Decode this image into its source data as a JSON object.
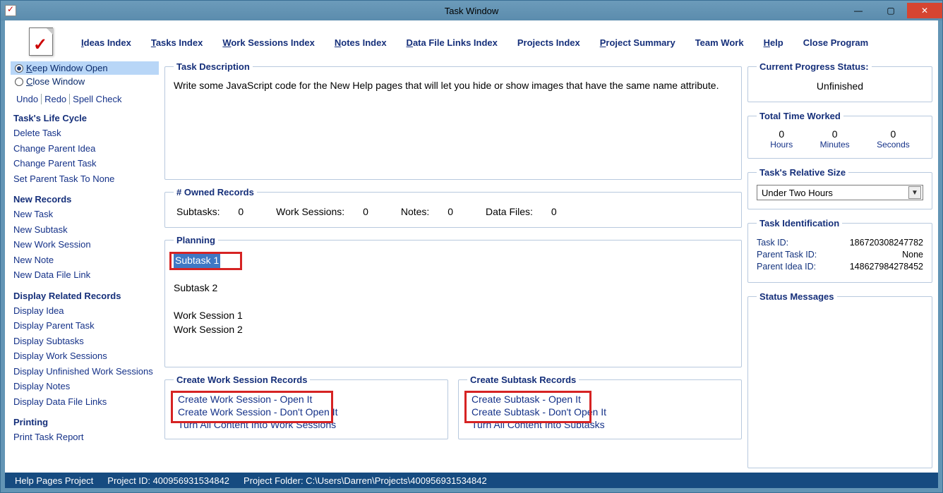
{
  "window": {
    "title": "Task Window"
  },
  "nav": {
    "ideas": "Ideas Index",
    "tasks": "Tasks Index",
    "work_sessions": "Work Sessions Index",
    "notes": "Notes Index",
    "data_file_links": "Data File Links Index",
    "projects": "Projects Index",
    "project_summary": "Project Summary",
    "team_work": "Team Work",
    "help": "Help",
    "close": "Close Program"
  },
  "sidebar": {
    "keep_open": "Keep Window Open",
    "close_window": "Close Window",
    "undo": "Undo",
    "redo": "Redo",
    "spell": "Spell Check",
    "life_cycle_head": "Task's Life Cycle",
    "life_cycle": [
      "Delete Task",
      "Change Parent Idea",
      "Change Parent Task",
      "Set Parent Task To None"
    ],
    "new_records_head": "New Records",
    "new_records": [
      "New Task",
      "New Subtask",
      "New Work Session",
      "New Note",
      "New Data File Link"
    ],
    "display_head": "Display Related Records",
    "display": [
      "Display Idea",
      "Display Parent Task",
      "Display Subtasks",
      "Display Work Sessions",
      "Display Unfinished Work Sessions",
      "Display Notes",
      "Display Data File Links"
    ],
    "printing_head": "Printing",
    "printing": [
      "Print Task Report"
    ]
  },
  "task_description": {
    "legend": "Task Description",
    "text": "Write some JavaScript code for the New Help pages that will let you hide or show images that have the same name attribute."
  },
  "owned": {
    "legend": "# Owned Records",
    "subtasks_label": "Subtasks:",
    "subtasks_val": "0",
    "ws_label": "Work Sessions:",
    "ws_val": "0",
    "notes_label": "Notes:",
    "notes_val": "0",
    "df_label": "Data Files:",
    "df_val": "0"
  },
  "planning": {
    "legend": "Planning",
    "subtask1": "Subtask 1",
    "subtask2": "Subtask 2",
    "ws1": "Work Session 1",
    "ws2": "Work Session 2"
  },
  "create_ws": {
    "legend": "Create Work Session Records",
    "open": "Create Work Session - Open It",
    "dont": "Create Work Session - Don't Open It",
    "turn_all": "Turn All Content Into Work Sessions"
  },
  "create_st": {
    "legend": "Create Subtask Records",
    "open": "Create Subtask - Open It",
    "dont": "Create Subtask - Don't Open It",
    "turn_all": "Turn All Content Into Subtasks"
  },
  "progress": {
    "legend": "Current Progress Status:",
    "value": "Unfinished"
  },
  "time": {
    "legend": "Total Time Worked",
    "hours_v": "0",
    "hours_l": "Hours",
    "min_v": "0",
    "min_l": "Minutes",
    "sec_v": "0",
    "sec_l": "Seconds"
  },
  "rel_size": {
    "legend": "Task's Relative Size",
    "value": "Under Two Hours"
  },
  "ident": {
    "legend": "Task Identification",
    "task_id_l": "Task ID:",
    "task_id_v": "186720308247782",
    "parent_task_l": "Parent Task ID:",
    "parent_task_v": "None",
    "parent_idea_l": "Parent Idea ID:",
    "parent_idea_v": "148627984278452"
  },
  "status_msg": {
    "legend": "Status Messages"
  },
  "statusbar": {
    "project_name": "Help Pages Project",
    "project_id": "Project ID: 400956931534842",
    "project_folder": "Project Folder: C:\\Users\\Darren\\Projects\\400956931534842"
  }
}
